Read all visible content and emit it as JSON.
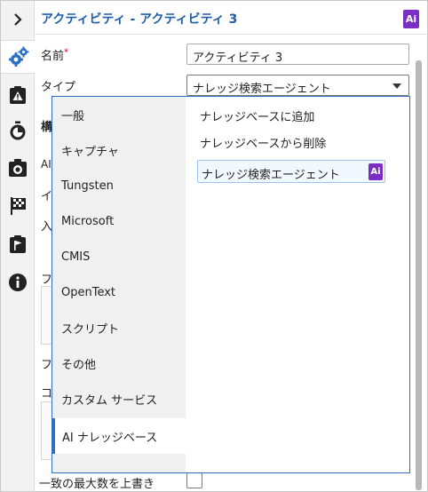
{
  "header": {
    "title": "アクティビティ - アクティビティ 3",
    "ai_badge": "Ai"
  },
  "rail": {
    "items": [
      {
        "icon": "chevron-right-icon"
      },
      {
        "icon": "gears-icon"
      },
      {
        "icon": "warning-clipboard-icon"
      },
      {
        "icon": "timer-icon"
      },
      {
        "icon": "camera-clipboard-icon"
      },
      {
        "icon": "checkered-flag-icon"
      },
      {
        "icon": "flag-clipboard-icon"
      },
      {
        "icon": "info-icon"
      }
    ]
  },
  "form": {
    "name_label": "名前",
    "name_required_mark": "*",
    "name_value": "アクティビティ 3",
    "type_label": "タイプ",
    "type_value": "ナレッジ検索エージェント",
    "occluded_label_fragments": [
      "構",
      "AI",
      "イ",
      "入",
      "フ",
      "フ",
      "コ"
    ],
    "override_label": "一致の最大数を上書き"
  },
  "dropdown": {
    "categories": [
      {
        "label": "一般",
        "selected": false
      },
      {
        "label": "キャプチャ",
        "selected": false
      },
      {
        "label": "Tungsten",
        "selected": false
      },
      {
        "label": "Microsoft",
        "selected": false
      },
      {
        "label": "CMIS",
        "selected": false
      },
      {
        "label": "OpenText",
        "selected": false
      },
      {
        "label": "スクリプト",
        "selected": false
      },
      {
        "label": "その他",
        "selected": false
      },
      {
        "label": "カスタム サービス",
        "selected": false
      },
      {
        "label": "AI ナレッジベース",
        "selected": true
      }
    ],
    "options": [
      {
        "label": "ナレッジベースに追加",
        "selected": false
      },
      {
        "label": "ナレッジベースから削除",
        "selected": false
      },
      {
        "label": "ナレッジ検索エージェント",
        "selected": true,
        "badge": "Ai"
      }
    ]
  },
  "colors": {
    "title": "#1f5ea8",
    "ai_badge": "#7b2ec4",
    "selection_border": "#2e6fc4",
    "required": "#d0021b"
  }
}
